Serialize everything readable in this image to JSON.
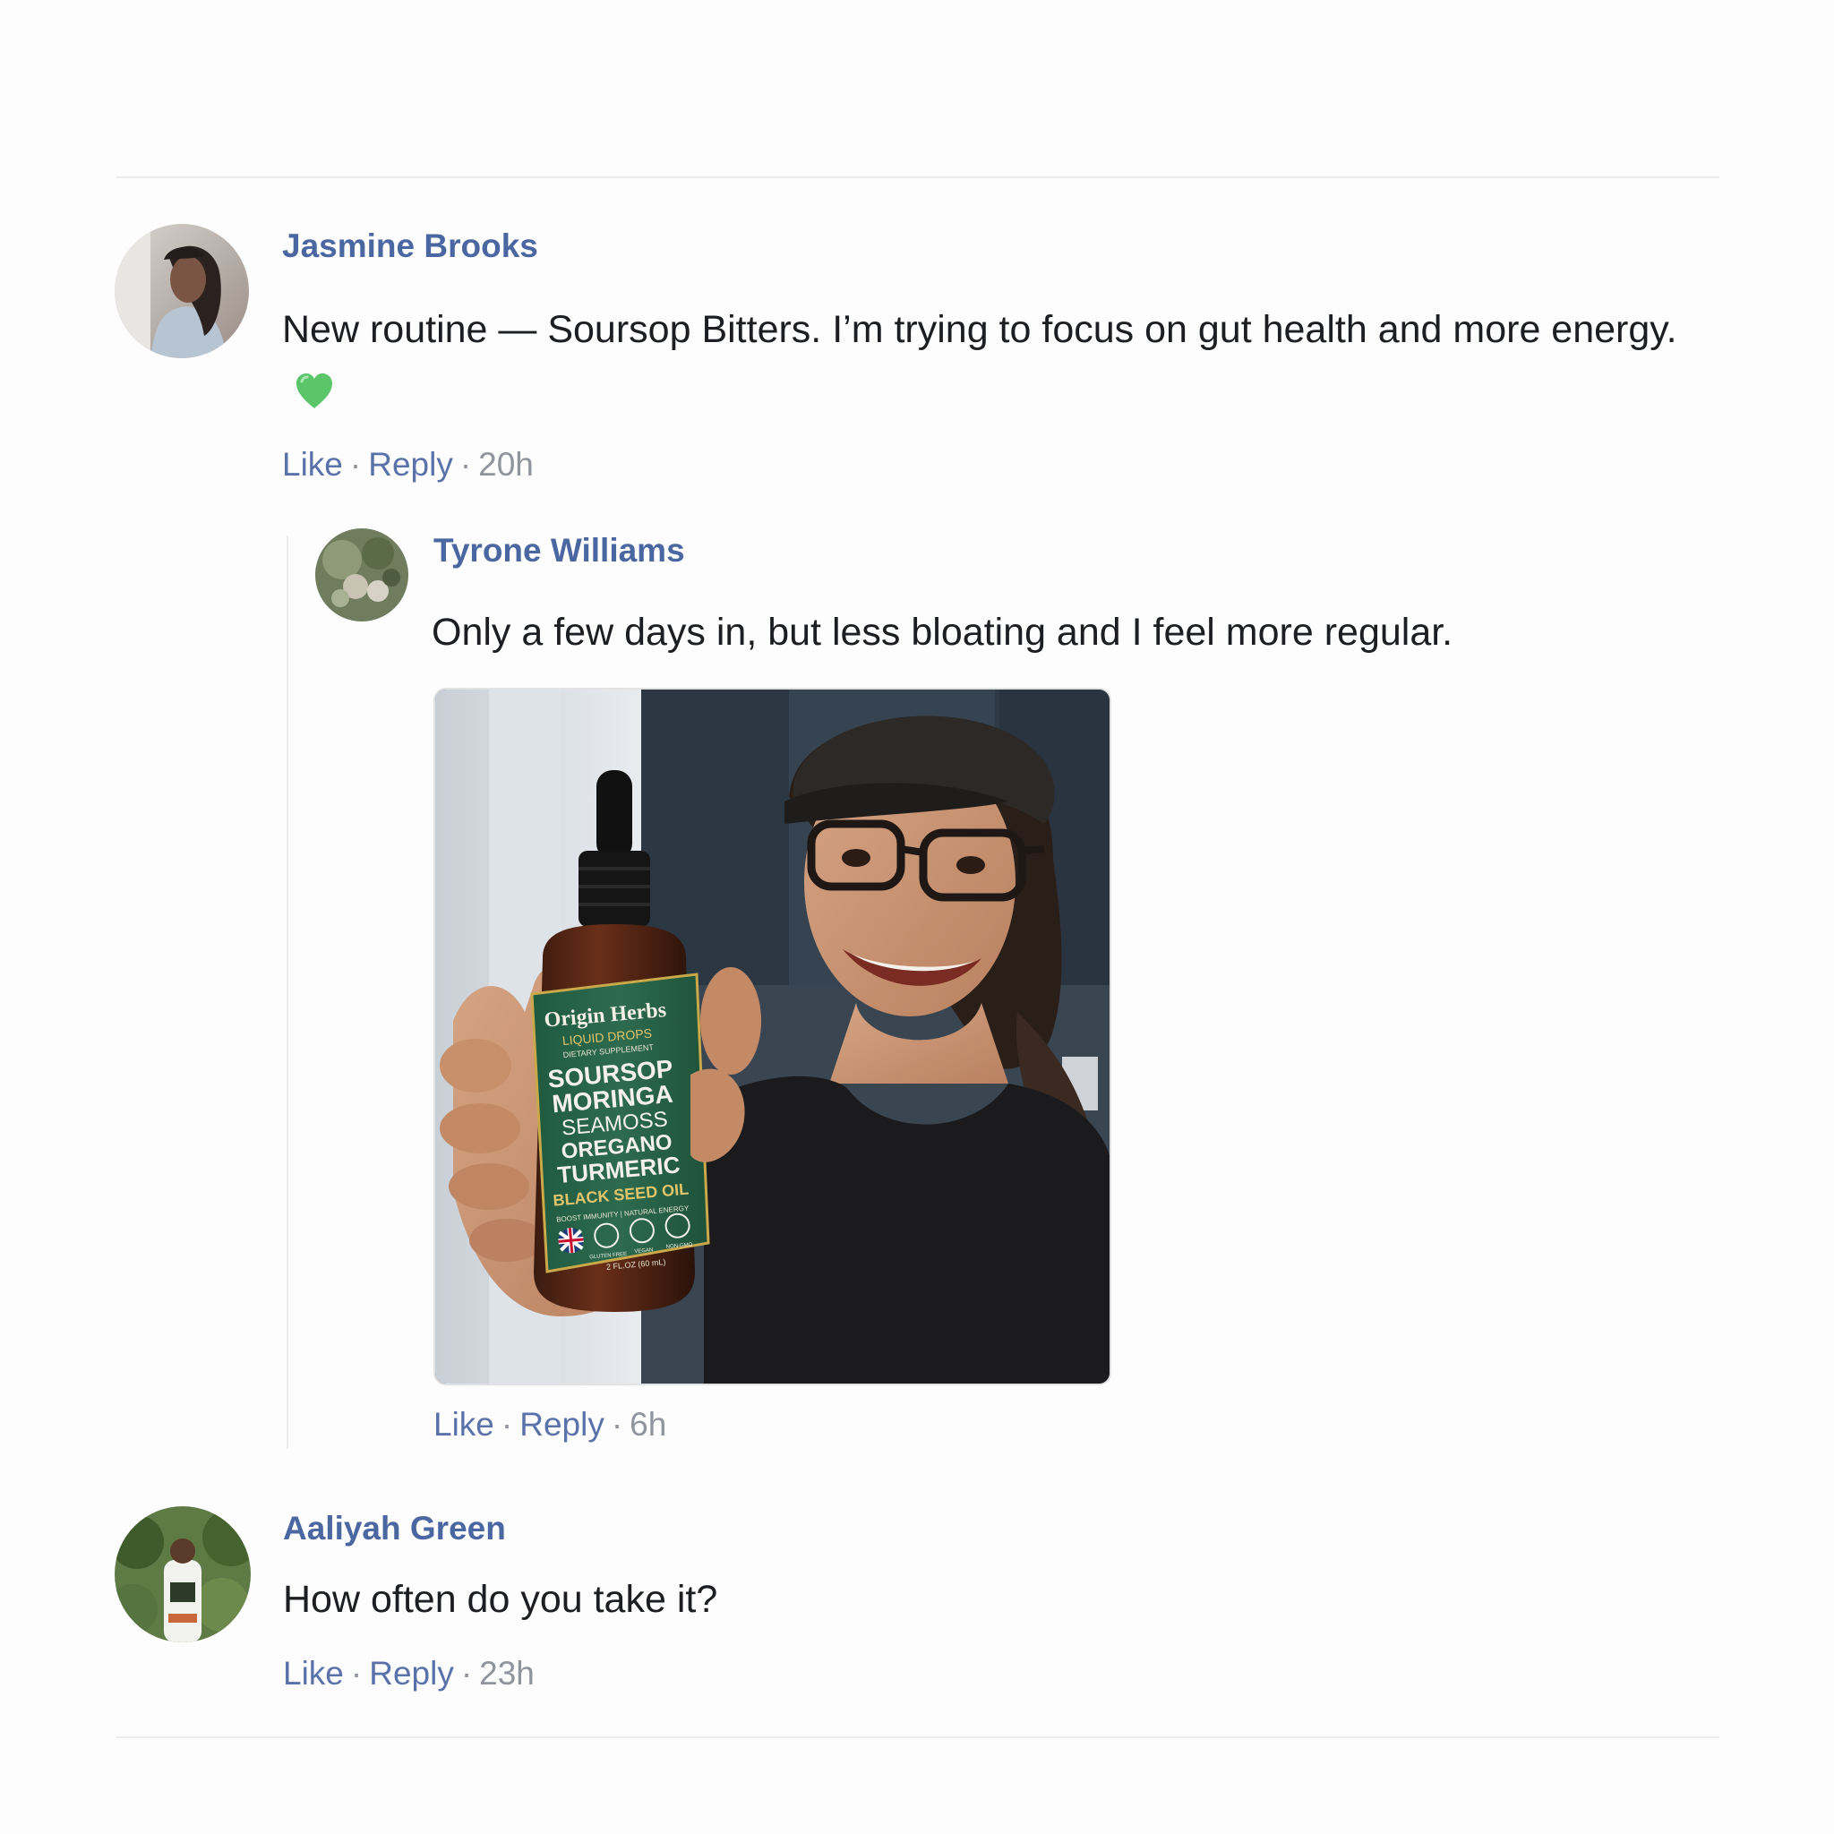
{
  "comments": [
    {
      "author": "Jasmine Brooks",
      "text": "New routine — Soursop Bitters. I’m trying to focus on gut health and more energy.",
      "emoji": "green-heart-icon",
      "like_label": "Like",
      "reply_label": "Reply",
      "separator": "·",
      "time": "20h"
    },
    {
      "author": "Tyrone Williams",
      "text": "Only a few days in, but less bloating and I feel more regular.",
      "like_label": "Like",
      "reply_label": "Reply",
      "separator": "·",
      "time": "6h",
      "photo": {
        "brand": "Origin Herbs",
        "line": "LIQUID DROPS",
        "subline": "DIETARY SUPPLEMENT",
        "ingredients": [
          "SOURSOP",
          "MORINGA",
          "SEAMOSS",
          "OREGANO",
          "TURMERIC"
        ],
        "highlight": "BLACK SEED OIL",
        "benefits": "BOOST IMMUNITY | NATURAL ENERGY",
        "badges": [
          "GLUTEN FREE",
          "VEGAN",
          "NON-GMO"
        ],
        "volume": "2 FL.OZ (60 mL)"
      }
    },
    {
      "author": "Aaliyah Green",
      "text": "How often do you take it?",
      "like_label": "Like",
      "reply_label": "Reply",
      "separator": "·",
      "time": "23h"
    }
  ],
  "colors": {
    "name": "#4b67a1",
    "link": "#5a72aa",
    "meta": "#90949c",
    "label_green": "#2e6b4e"
  }
}
